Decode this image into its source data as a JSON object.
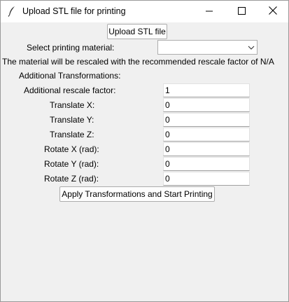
{
  "window": {
    "title": "Upload STL file for printing",
    "icons": [
      "feather-icon",
      "minimize-icon",
      "maximize-icon",
      "close-icon"
    ]
  },
  "upload": {
    "button_label": "Upload STL file"
  },
  "material": {
    "label": "Select printing material:",
    "selected": ""
  },
  "info_text": "The material will be rescaled with the recommended rescale factor of N/A",
  "transforms": {
    "heading": "Additional Transformations:",
    "fields": [
      {
        "label": "Additional rescale factor:",
        "value": "1"
      },
      {
        "label": "Translate X:",
        "value": "0"
      },
      {
        "label": "Translate Y:",
        "value": "0"
      },
      {
        "label": "Translate Z:",
        "value": "0"
      },
      {
        "label": "Rotate X (rad):",
        "value": "0"
      },
      {
        "label": "Rotate Y (rad):",
        "value": "0"
      },
      {
        "label": "Rotate Z (rad):",
        "value": "0"
      }
    ]
  },
  "apply": {
    "button_label": "Apply Transformations and Start Printing"
  }
}
